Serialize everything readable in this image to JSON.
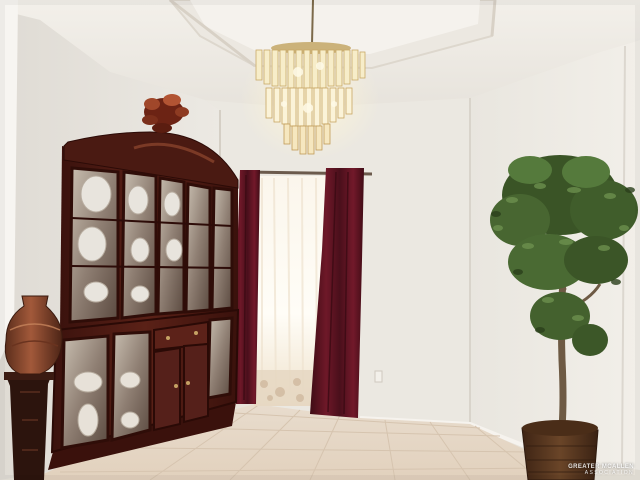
{
  "scene": {
    "description_colors": {
      "wall": "#ebe8e1",
      "ceiling": "#f1eee8",
      "floor_tile": "#e6d6c4",
      "cabinet_wood": "#4d1a14",
      "curtain": "#5e1420",
      "sheer_curtain": "#f4ece1",
      "window_light": "#fdfaf2",
      "plant_leaf": "#3f5a2a",
      "basket": "#5a3a22",
      "vase": "#8c4a2e"
    }
  },
  "watermark": {
    "brand": "GREATER MCALLEN",
    "region": "ASSOCIATION"
  }
}
